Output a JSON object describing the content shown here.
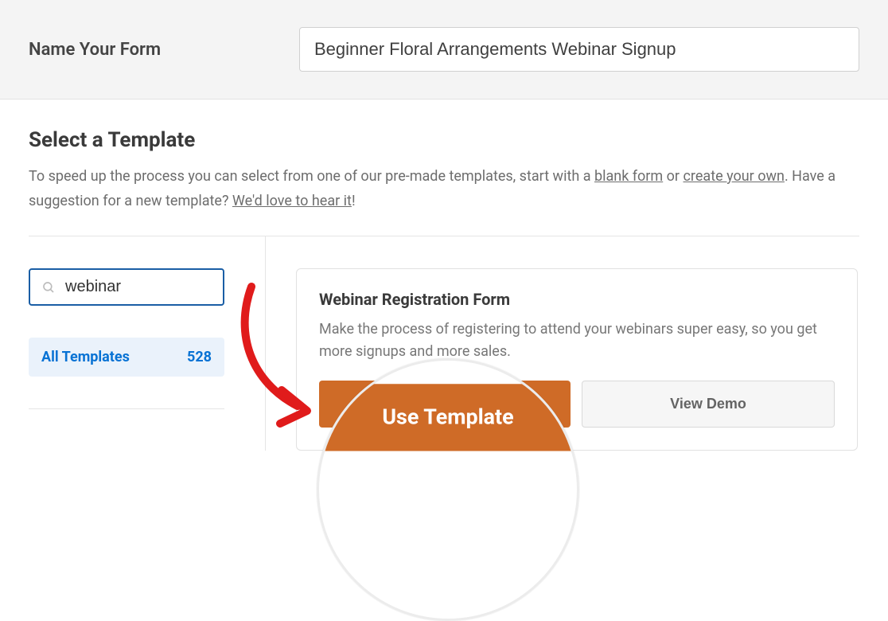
{
  "topbar": {
    "label": "Name Your Form",
    "value": "Beginner Floral Arrangements Webinar Signup"
  },
  "headings": {
    "select_template": "Select a Template"
  },
  "description": {
    "pre1": "To speed up the process you can select from one of our pre-made templates, start with a ",
    "blank_form": "blank form",
    "mid1": " or ",
    "create_your_own": "create your own",
    "post1": ". Have a suggestion for a new template? ",
    "love_to_hear": "We'd love to hear it",
    "end": "!"
  },
  "search": {
    "value": "webinar"
  },
  "sidebar": {
    "category_label": "All Templates",
    "category_count": "528"
  },
  "template": {
    "title": "Webinar Registration Form",
    "desc": "Make the process of registering to attend your webinars super easy, so you get more signups and more sales.",
    "use_label": "Use Template",
    "demo_label": "View Demo"
  },
  "lens": {
    "use_label": "Use Template"
  }
}
